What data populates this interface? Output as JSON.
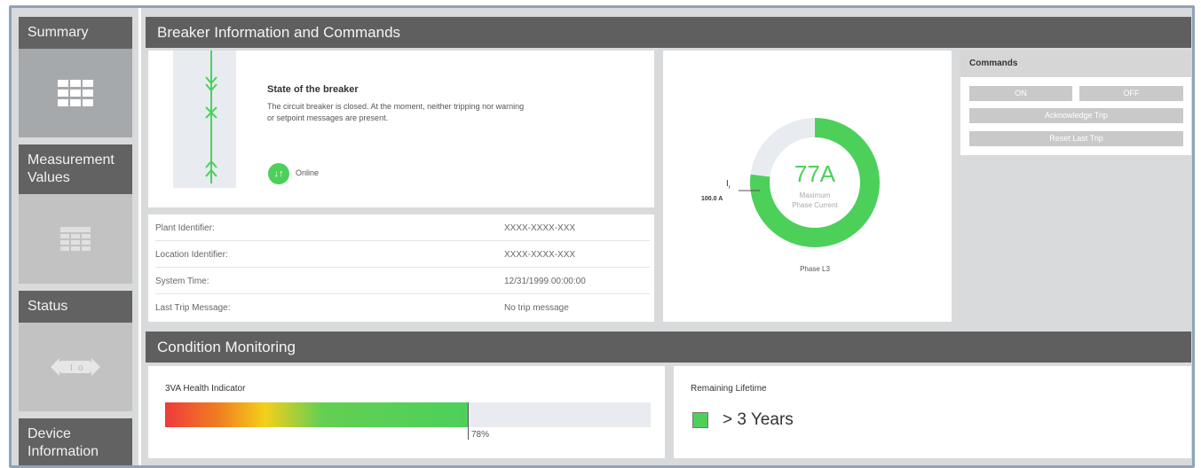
{
  "sidebar": {
    "items": [
      {
        "label": "Summary",
        "icon": "grid-icon"
      },
      {
        "label": "Measurement Values",
        "icon": "table-icon"
      },
      {
        "label": "Status",
        "icon": "switch-icon"
      },
      {
        "label": "Device Information",
        "icon": ""
      }
    ]
  },
  "breaker": {
    "header": "Breaker Information and Commands",
    "state_title": "State of the breaker",
    "state_text": "The circuit breaker is closed. At the moment, neither tripping nor warning or setpoint messages are present.",
    "online_label": "Online",
    "info": [
      {
        "label": "Plant Identifier:",
        "value": "XXXX-XXXX-XXX"
      },
      {
        "label": "Location Identifier:",
        "value": "XXXX-XXXX-XXX"
      },
      {
        "label": "System Time:",
        "value": "12/31/1999 00:00:00"
      },
      {
        "label": "Last Trip Message:",
        "value": "No trip message"
      }
    ]
  },
  "gauge": {
    "value": "77A",
    "caption_line1": "Maximum",
    "caption_line2": "Phase Current",
    "ir_symbol": "I",
    "ir_subscript": "r",
    "ir_value": "100.0 A",
    "phase": "Phase L3",
    "fill_fraction": 0.77,
    "color": "#4cd05a"
  },
  "commands": {
    "title": "Commands",
    "on": "ON",
    "off": "OFF",
    "ack": "Acknowledge Trip",
    "reset": "Reset Last Trip"
  },
  "condition": {
    "header": "Condition Monitoring",
    "health_label": "3VA Health Indicator",
    "health_value": "78%",
    "health_fraction": 0.78,
    "lifetime_label": "Remaining Lifetime",
    "lifetime_value": "> 3 Years",
    "lifetime_color": "#4cd05a"
  }
}
